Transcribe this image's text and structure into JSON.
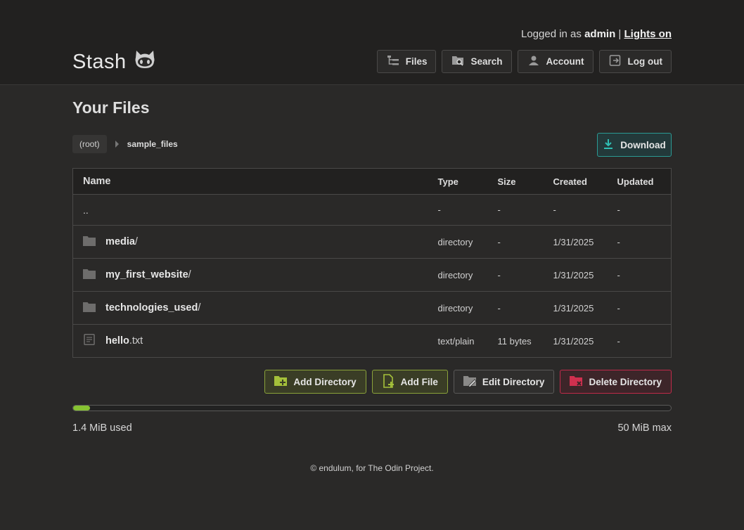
{
  "header": {
    "login_prefix": "Logged in as",
    "username": "admin",
    "separator": "|",
    "lights_link": "Lights on",
    "brand": "Stash",
    "nav": [
      {
        "label": "Files",
        "icon": "tree-icon"
      },
      {
        "label": "Search",
        "icon": "folder-search-icon"
      },
      {
        "label": "Account",
        "icon": "user-icon"
      },
      {
        "label": "Log out",
        "icon": "logout-icon"
      }
    ]
  },
  "page": {
    "title": "Your Files",
    "breadcrumb": {
      "root": "(root)",
      "current": "sample_files"
    },
    "download_label": "Download"
  },
  "table": {
    "columns": [
      "Name",
      "Type",
      "Size",
      "Created",
      "Updated"
    ],
    "rows": [
      {
        "name": "..",
        "ext": "",
        "type": "-",
        "size": "-",
        "created": "-",
        "updated": "-",
        "icon": ""
      },
      {
        "name": "media",
        "ext": "/",
        "type": "directory",
        "size": "-",
        "created": "1/31/2025",
        "updated": "-",
        "icon": "folder-icon"
      },
      {
        "name": "my_first_website",
        "ext": "/",
        "type": "directory",
        "size": "-",
        "created": "1/31/2025",
        "updated": "-",
        "icon": "folder-icon"
      },
      {
        "name": "technologies_used",
        "ext": "/",
        "type": "directory",
        "size": "-",
        "created": "1/31/2025",
        "updated": "-",
        "icon": "folder-icon"
      },
      {
        "name": "hello",
        "ext": ".txt",
        "type": "text/plain",
        "size": "11 bytes",
        "created": "1/31/2025",
        "updated": "-",
        "icon": "document-icon"
      }
    ]
  },
  "actions": {
    "add_directory": "Add Directory",
    "add_file": "Add File",
    "edit_directory": "Edit Directory",
    "delete_directory": "Delete Directory"
  },
  "storage": {
    "used_label": "1.4 MiB used",
    "max_label": "50 MiB max",
    "used_fraction": 0.028
  },
  "footer": {
    "text": "© endulum, for The Odin Project."
  },
  "colors": {
    "accent_green": "#86c232",
    "accent_teal": "#2b9a94",
    "accent_red": "#c02a4a"
  }
}
